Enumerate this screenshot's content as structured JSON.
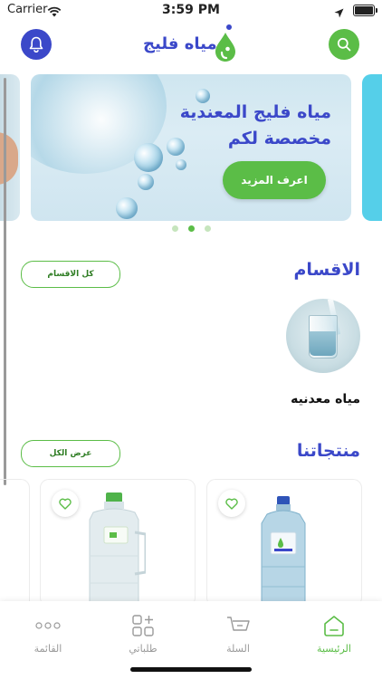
{
  "status_bar": {
    "carrier": "Carrier",
    "time": "3:59 PM"
  },
  "header": {
    "logo_text": "مياه فليج"
  },
  "banner": {
    "line1": "مياه فليج المعندية",
    "line2": "مخصصة لكم",
    "button_label": "اعرف المزيد",
    "page_count": 3,
    "active_index": 1
  },
  "categories": {
    "title": "الاقسام",
    "all_button": "كل الاقسام",
    "items": [
      {
        "label": "مياه معدنيه"
      }
    ]
  },
  "products": {
    "title": "منتجاتنا",
    "view_all_button": "عرض الكل"
  },
  "tabbar": {
    "items": [
      {
        "label": "القائمة",
        "icon": "more-icon"
      },
      {
        "label": "طلباتي",
        "icon": "grid-plus-icon"
      },
      {
        "label": "السلة",
        "icon": "cart-icon"
      },
      {
        "label": "الرئيسية",
        "icon": "home-icon",
        "active": true
      }
    ]
  },
  "colors": {
    "brand_blue": "#3b48c9",
    "brand_green": "#5bbd47"
  }
}
